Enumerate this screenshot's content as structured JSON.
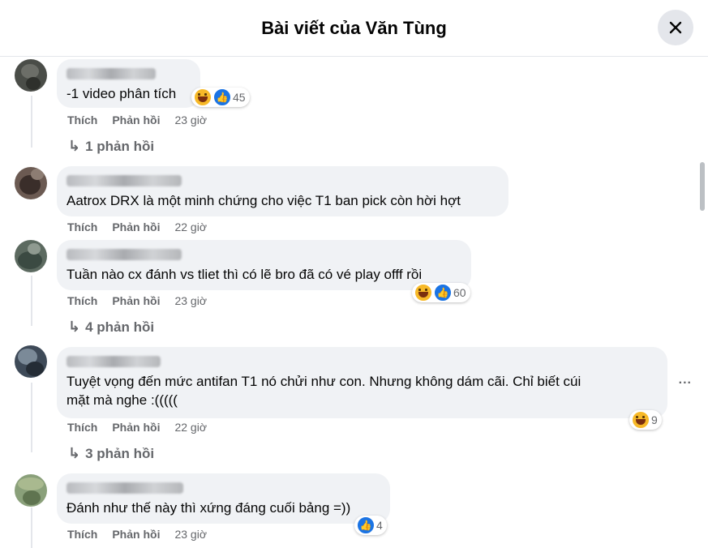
{
  "header": {
    "title": "Bài viết của Văn Tùng",
    "close_icon": "close-icon"
  },
  "comments": [
    {
      "text": "-1 video phân tích",
      "actions": {
        "like": "Thích",
        "reply": "Phản hồi",
        "time": "23 giờ"
      },
      "reactions": {
        "types": [
          "haha",
          "like"
        ],
        "count": "45"
      },
      "replies": "1 phản hồi"
    },
    {
      "text": "Aatrox DRX là một minh chứng cho việc T1 ban pick còn hời hợt",
      "actions": {
        "like": "Thích",
        "reply": "Phản hồi",
        "time": "22 giờ"
      }
    },
    {
      "text": "Tuần nào cx đánh vs tliet thì có lẽ bro đã có vé play offf rồi",
      "actions": {
        "like": "Thích",
        "reply": "Phản hồi",
        "time": "23 giờ"
      },
      "reactions": {
        "types": [
          "haha",
          "like"
        ],
        "count": "60"
      },
      "replies": "4 phản hồi"
    },
    {
      "text_line1": "Tuyệt vọng đến mức antifan T1 nó chửi như con. Nhưng không dám cãi. Chỉ biết cúi",
      "text_line2": "mặt mà nghe :(((((",
      "actions": {
        "like": "Thích",
        "reply": "Phản hồi",
        "time": "22 giờ"
      },
      "reactions": {
        "types": [
          "haha"
        ],
        "count": "9"
      },
      "replies": "3 phản hồi",
      "more": "..."
    },
    {
      "text": "Đánh như thế này thì xứng đáng cuối bảng =))",
      "actions": {
        "like": "Thích",
        "reply": "Phản hồi",
        "time": "23 giờ"
      },
      "reactions": {
        "types": [
          "like"
        ],
        "count": "4"
      }
    }
  ]
}
